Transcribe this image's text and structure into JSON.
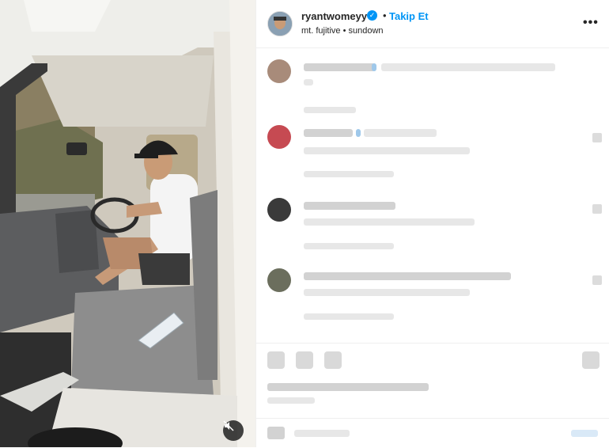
{
  "post": {
    "username": "ryantwomeyy",
    "follow_label": "Takip Et",
    "subtitle": "mt. fujitive • sundown",
    "separator": "•",
    "more_label": "•••",
    "verified_glyph": "✓"
  },
  "icons": {
    "verified": "verified-badge-icon",
    "more": "more-options-icon",
    "mute": "muted-speaker-icon",
    "like": "heart-icon",
    "comment": "comment-icon",
    "share": "share-icon",
    "save": "bookmark-icon"
  },
  "colors": {
    "accent": "#0095f6",
    "text": "#262626",
    "mute_bg": "#141414"
  }
}
